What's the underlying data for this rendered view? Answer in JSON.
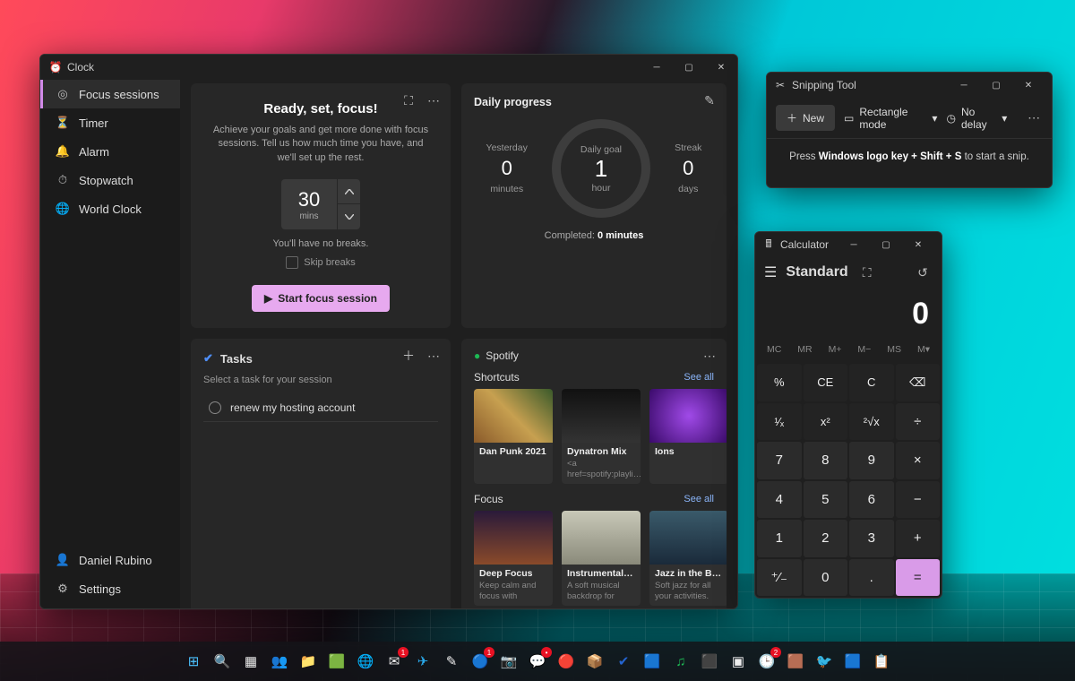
{
  "clock": {
    "title": "Clock",
    "nav": [
      {
        "icon": "target",
        "label": "Focus sessions",
        "active": true
      },
      {
        "icon": "timer",
        "label": "Timer"
      },
      {
        "icon": "bell",
        "label": "Alarm"
      },
      {
        "icon": "stopwatch",
        "label": "Stopwatch"
      },
      {
        "icon": "globe",
        "label": "World Clock"
      }
    ],
    "user": "Daniel Rubino",
    "settings": "Settings",
    "focus": {
      "heading": "Ready, set, focus!",
      "sub": "Achieve your goals and get more done with focus sessions. Tell us how much time you have, and we'll set up the rest.",
      "minutes": "30",
      "minutes_unit": "mins",
      "breaks_note": "You'll have no breaks.",
      "skip_label": "Skip breaks",
      "start_label": "Start focus session"
    },
    "tasks": {
      "heading": "Tasks",
      "prompt": "Select a task for your session",
      "items": [
        {
          "label": "renew my hosting account"
        }
      ]
    },
    "progress": {
      "heading": "Daily progress",
      "yesterday": {
        "label": "Yesterday",
        "value": "0",
        "unit": "minutes"
      },
      "goal": {
        "label": "Daily goal",
        "value": "1",
        "unit": "hour"
      },
      "streak": {
        "label": "Streak",
        "value": "0",
        "unit": "days"
      },
      "completed_prefix": "Completed: ",
      "completed_value": "0 minutes"
    },
    "spotify": {
      "brand": "Spotify",
      "see_all": "See all",
      "shortcuts_label": "Shortcuts",
      "shortcuts": [
        {
          "title": "Dan Punk 2021",
          "sub": "",
          "art": "collage"
        },
        {
          "title": "Dynatron Mix",
          "sub": "<a href=spotify:playli…",
          "art": "dark"
        },
        {
          "title": "Ions",
          "sub": "",
          "art": "violet"
        }
      ],
      "focus_label": "Focus",
      "focus": [
        {
          "title": "Deep Focus",
          "sub": "Keep calm and focus with ambient and…",
          "art": "sunset"
        },
        {
          "title": "Instrumental Study",
          "sub": "A soft musical backdrop for your…",
          "art": "study"
        },
        {
          "title": "Jazz in the Backg…",
          "sub": "Soft jazz for all your activities.",
          "art": "jazz"
        }
      ]
    }
  },
  "snip": {
    "title": "Snipping Tool",
    "new_label": "New",
    "mode": "Rectangle mode",
    "delay": "No delay",
    "hint_prefix": "Press ",
    "hint_combo": "Windows logo key + Shift + S",
    "hint_suffix": " to start a snip."
  },
  "calc": {
    "title": "Calculator",
    "mode": "Standard",
    "display": "0",
    "memory": [
      "MC",
      "MR",
      "M+",
      "M−",
      "MS",
      "M▾"
    ],
    "keys": [
      [
        "%",
        "fn"
      ],
      [
        "CE",
        "fn"
      ],
      [
        "C",
        "fn"
      ],
      [
        "⌫",
        "fn"
      ],
      [
        "¹⁄ₓ",
        "fn"
      ],
      [
        "x²",
        "fn"
      ],
      [
        "²√x",
        "fn"
      ],
      [
        "÷",
        "op"
      ],
      [
        "7",
        ""
      ],
      [
        "8",
        ""
      ],
      [
        "9",
        ""
      ],
      [
        "×",
        "op"
      ],
      [
        "4",
        ""
      ],
      [
        "5",
        ""
      ],
      [
        "6",
        ""
      ],
      [
        "−",
        "op"
      ],
      [
        "1",
        ""
      ],
      [
        "2",
        ""
      ],
      [
        "3",
        ""
      ],
      [
        "+",
        "op"
      ],
      [
        "⁺⁄₋",
        ""
      ],
      [
        "0",
        ""
      ],
      [
        ".",
        ""
      ],
      [
        "=",
        "eq"
      ]
    ]
  },
  "taskbar": {
    "items": [
      {
        "name": "start",
        "glyph": "⊞",
        "color": "#4cc2ff"
      },
      {
        "name": "search",
        "glyph": "🔍"
      },
      {
        "name": "task-view",
        "glyph": "▦"
      },
      {
        "name": "teams",
        "glyph": "👥",
        "color": "#6264a7"
      },
      {
        "name": "explorer",
        "glyph": "📁"
      },
      {
        "name": "app-1",
        "glyph": "🟩"
      },
      {
        "name": "browser",
        "glyph": "🌐"
      },
      {
        "name": "mail",
        "glyph": "✉",
        "badge": "1"
      },
      {
        "name": "telegram",
        "glyph": "✈",
        "color": "#29a9ea"
      },
      {
        "name": "pen",
        "glyph": "✎"
      },
      {
        "name": "app-2",
        "glyph": "🔵",
        "badge": "1"
      },
      {
        "name": "camera",
        "glyph": "📷"
      },
      {
        "name": "discord",
        "glyph": "💬",
        "color": "#5865f2",
        "badge": "•"
      },
      {
        "name": "app-red",
        "glyph": "🔴"
      },
      {
        "name": "fedex",
        "glyph": "📦"
      },
      {
        "name": "todo",
        "glyph": "✔",
        "color": "#2564cf"
      },
      {
        "name": "app-3",
        "glyph": "🟦"
      },
      {
        "name": "spotify",
        "glyph": "♫",
        "color": "#1db954"
      },
      {
        "name": "app-4",
        "glyph": "⬛"
      },
      {
        "name": "terminal",
        "glyph": "▣"
      },
      {
        "name": "clock",
        "glyph": "🕒",
        "badge": "2"
      },
      {
        "name": "app-5",
        "glyph": "🟫"
      },
      {
        "name": "twitter",
        "glyph": "🐦",
        "color": "#1da1f2"
      },
      {
        "name": "app-6",
        "glyph": "🟦"
      },
      {
        "name": "app-7",
        "glyph": "📋"
      }
    ]
  }
}
